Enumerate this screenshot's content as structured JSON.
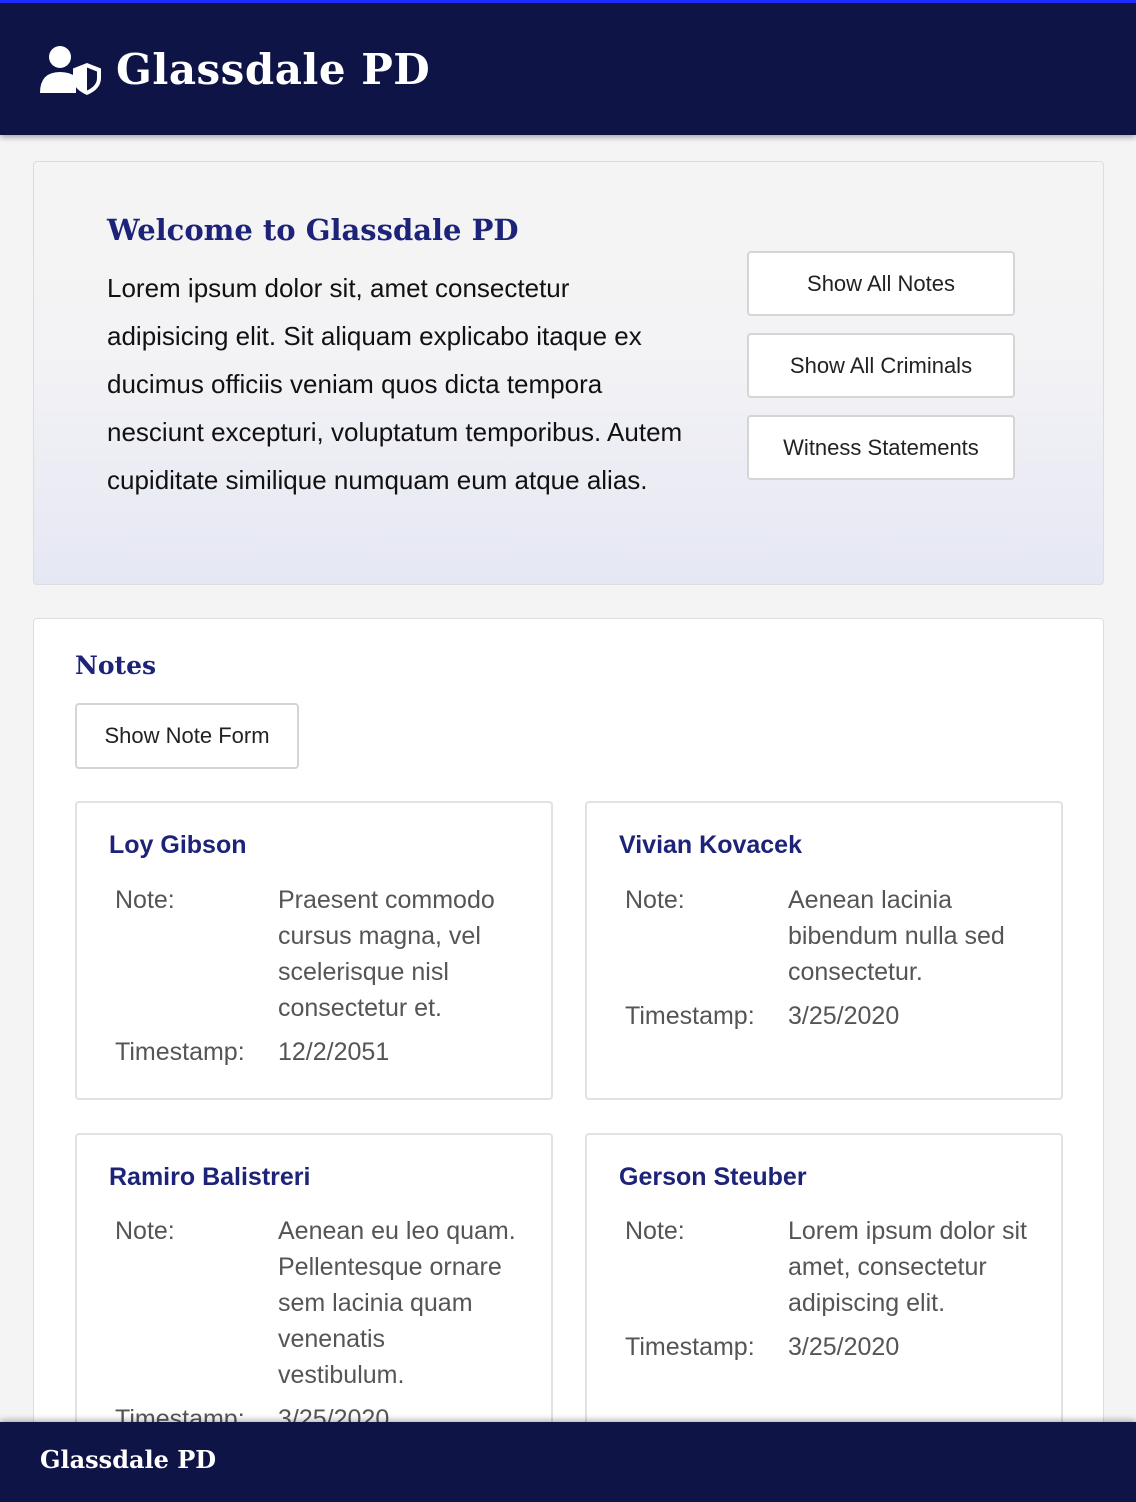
{
  "header": {
    "title": "Glassdale PD",
    "icon": "user-shield-icon"
  },
  "hero": {
    "title": "Welcome to Glassdale PD",
    "text": "Lorem ipsum dolor sit, amet consectetur adipisicing elit. Sit aliquam explicabo itaque ex ducimus officiis veniam quos dicta tempora nesciunt excepturi, voluptatum temporibus. Autem cupiditate similique numquam eum atque alias.",
    "buttons": [
      "Show All Notes",
      "Show All Criminals",
      "Witness Statements"
    ]
  },
  "notes": {
    "title": "Notes",
    "form_button": "Show Note Form",
    "note_label": "Note:",
    "timestamp_label": "Timestamp:",
    "cards": [
      {
        "name": "Loy Gibson",
        "note": "Praesent commodo cursus magna, vel scelerisque nisl consectetur et.",
        "timestamp": "12/2/2051"
      },
      {
        "name": "Vivian Kovacek",
        "note": "Aenean lacinia bibendum nulla sed consectetur.",
        "timestamp": "3/25/2020"
      },
      {
        "name": "Ramiro Balistreri",
        "note": "Aenean eu leo quam. Pellentesque ornare sem lacinia quam venenatis vestibulum.",
        "timestamp": "3/25/2020"
      },
      {
        "name": "Gerson Steuber",
        "note": "Lorem ipsum dolor sit amet, consectetur adipiscing elit.",
        "timestamp": "3/25/2020"
      }
    ]
  },
  "footer": {
    "title": "Glassdale PD"
  },
  "colors": {
    "navy": "#0f1447",
    "heading": "#1d2378",
    "top_border": "#1d2cff"
  }
}
